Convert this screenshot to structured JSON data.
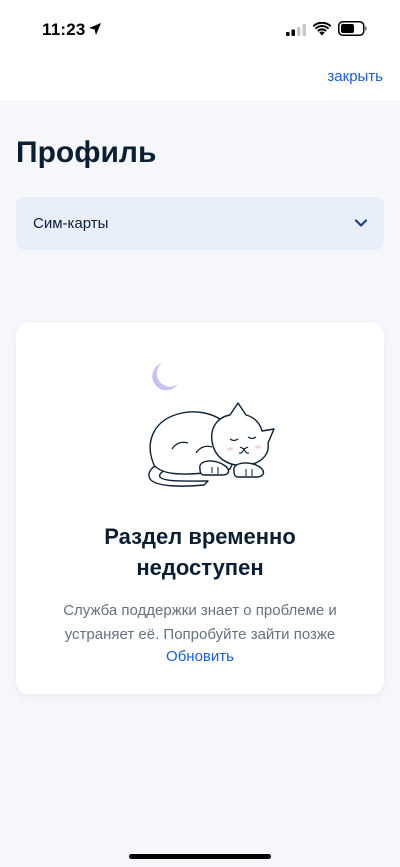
{
  "status_bar": {
    "time": "11:23",
    "icons": [
      "location-arrow-icon",
      "cellular-signal-icon",
      "wifi-icon",
      "battery-icon"
    ]
  },
  "top_bar": {
    "close_label": "закрыть"
  },
  "page": {
    "title": "Профиль"
  },
  "select": {
    "value": "Сим-карты",
    "icon": "chevron-down-icon"
  },
  "error_card": {
    "illustration": "sleeping-cat-with-moon-illustration",
    "title_line1": "Раздел временно",
    "title_line2": "недоступен",
    "message_line1": "Служба поддержки знает о проблеме и",
    "message_line2": "устраняет её. Попробуйте зайти позже",
    "refresh_label": "Обновить"
  },
  "colors": {
    "accent": "#1a5fd6",
    "text_primary": "#0b1f33",
    "text_secondary": "#66727f",
    "select_bg": "#e9eefb",
    "page_bg": "#f6f7fb",
    "moon": "#c9c1f2"
  }
}
